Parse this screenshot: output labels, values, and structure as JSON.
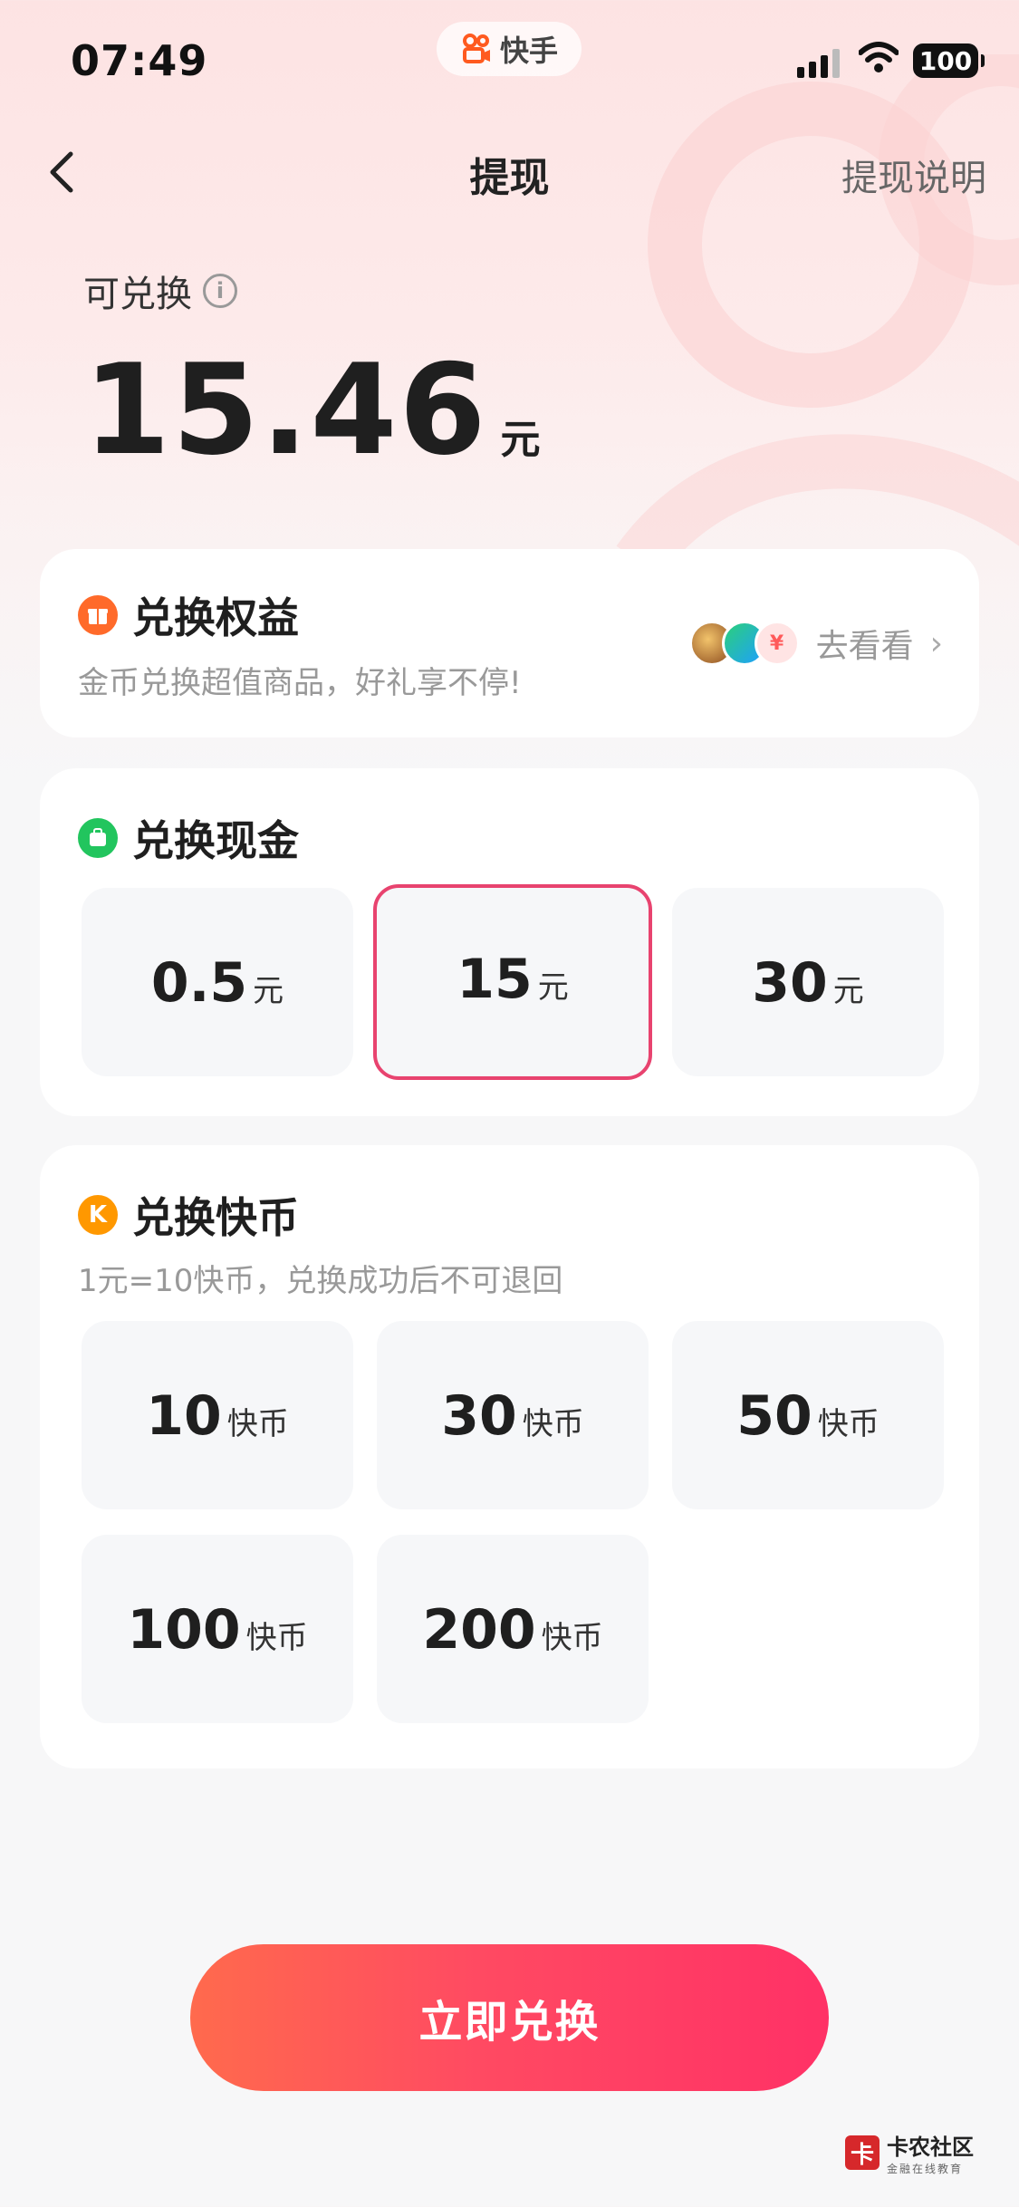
{
  "status_bar": {
    "time": "07:49",
    "app_name": "快手",
    "battery": "100"
  },
  "nav": {
    "title": "提现",
    "right_link": "提现说明"
  },
  "balance": {
    "label": "可兑换",
    "amount": "15.46",
    "unit": "元"
  },
  "rights": {
    "title": "兑换权益",
    "subtitle": "金币兑换超值商品，好礼享不停!",
    "link": "去看看",
    "badge_glyph": "¥"
  },
  "cash": {
    "title": "兑换现金",
    "options": [
      {
        "value": "0.5",
        "unit": "元"
      },
      {
        "value": "15",
        "unit": "元",
        "selected": true
      },
      {
        "value": "30",
        "unit": "元"
      }
    ]
  },
  "coins": {
    "title": "兑换快币",
    "icon_letter": "K",
    "note": "1元=10快币，兑换成功后不可退回",
    "options": [
      {
        "value": "10",
        "unit": "快币"
      },
      {
        "value": "30",
        "unit": "快币"
      },
      {
        "value": "50",
        "unit": "快币"
      },
      {
        "value": "100",
        "unit": "快币"
      },
      {
        "value": "200",
        "unit": "快币"
      }
    ]
  },
  "cta": {
    "label": "立即兑换"
  },
  "watermark": {
    "main": "卡农社区",
    "sub": "金融在线教育",
    "mark": "卡"
  },
  "colors": {
    "accent": "#e8436f",
    "cta_start": "#ff6a4d",
    "cta_end": "#ff3166",
    "rights_icon": "#ff6a2a",
    "cash_icon": "#22c55e",
    "coin_icon": "#ff9800"
  }
}
